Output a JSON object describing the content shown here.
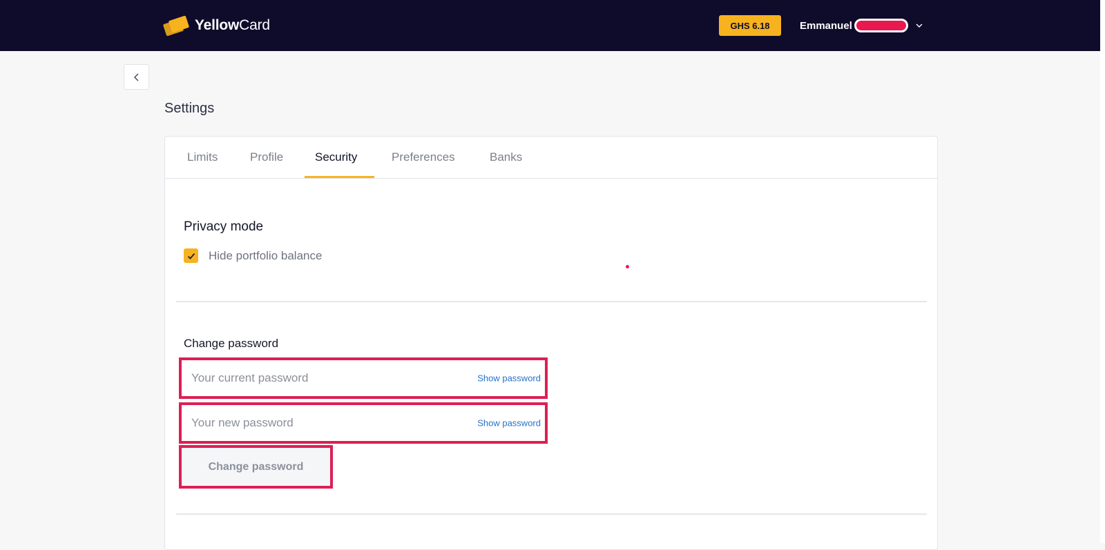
{
  "header": {
    "logo": {
      "brand_bold": "Yellow",
      "brand_light": "Card",
      "icon": "yellowcard-cards-icon"
    },
    "balance_badge": "GHS 6.18",
    "user_name": "Emmanuel",
    "menu_icon": "chevron-down-icon"
  },
  "nav": {
    "back_icon": "chevron-left-icon"
  },
  "page": {
    "title": "Settings"
  },
  "tabs": [
    {
      "label": "Limits"
    },
    {
      "label": "Profile"
    },
    {
      "label": "Security",
      "active": true
    },
    {
      "label": "Preferences"
    },
    {
      "label": "Banks"
    }
  ],
  "privacy": {
    "title": "Privacy mode",
    "checkbox_label": "Hide portfolio balance",
    "checked": true,
    "check_icon": "checkmark-icon"
  },
  "change_password": {
    "title": "Change password",
    "current_placeholder": "Your current password",
    "new_placeholder": "Your new password",
    "show_label": "Show password",
    "button_label": "Change password"
  },
  "colors": {
    "header_bg": "#0f0b2b",
    "accent_yellow": "#f7b21f",
    "highlight_red": "#dc1f54",
    "link_blue": "#2573c9"
  }
}
